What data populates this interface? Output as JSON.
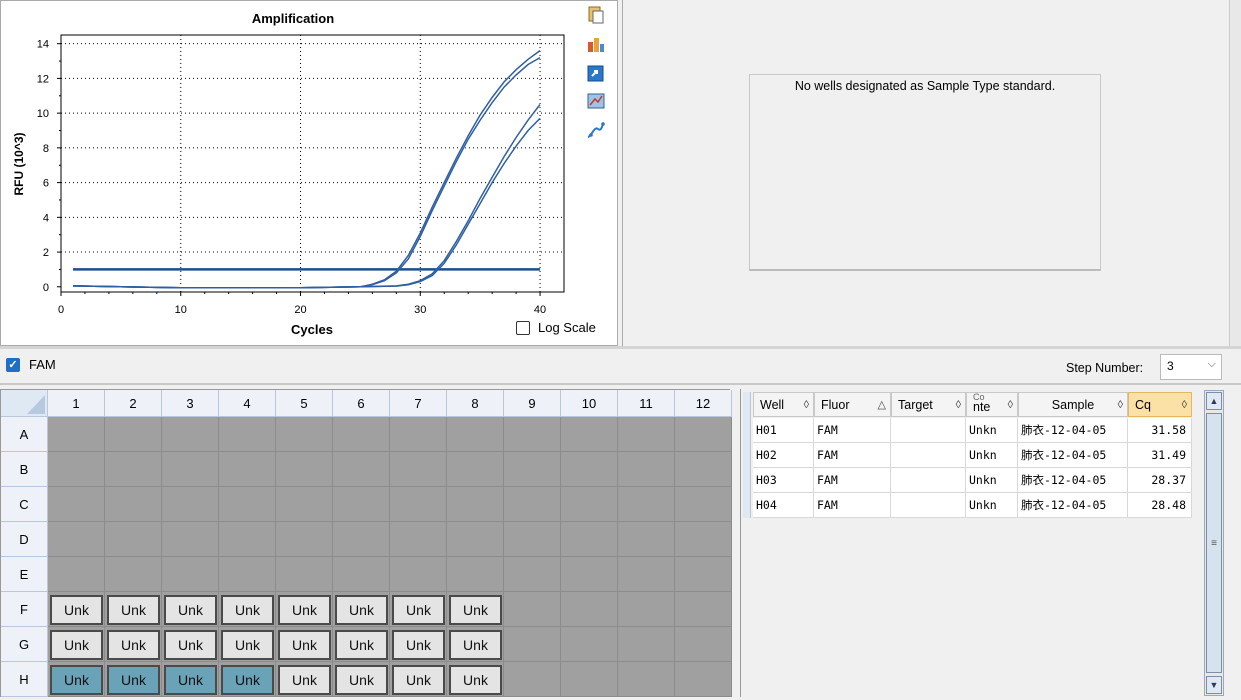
{
  "chart": {
    "log_scale_label": "Log Scale",
    "log_scale_checked": false
  },
  "chart_data": {
    "type": "line",
    "title": "Amplification",
    "xlabel": "Cycles",
    "ylabel": "RFU (10^3)",
    "xlim": [
      0,
      42
    ],
    "ylim": [
      -0.3,
      14.5
    ],
    "xticks": [
      "0",
      "10",
      "20",
      "30",
      "40"
    ],
    "yticks": [
      "0",
      "2",
      "4",
      "6",
      "8",
      "10",
      "12",
      "14"
    ],
    "grid": true,
    "threshold": 1.0,
    "series": [
      {
        "x": [
          1,
          5,
          10,
          15,
          20,
          25,
          26,
          27,
          28,
          29,
          30,
          31,
          32,
          33,
          34,
          35,
          36,
          37,
          38,
          39,
          40
        ],
        "y": [
          0.05,
          0.0,
          -0.05,
          -0.05,
          -0.05,
          0.0,
          0.15,
          0.4,
          0.9,
          1.8,
          3.1,
          4.6,
          6.0,
          7.4,
          8.7,
          9.9,
          10.9,
          11.8,
          12.5,
          13.1,
          13.6
        ]
      },
      {
        "x": [
          1,
          5,
          10,
          15,
          20,
          25,
          26,
          27,
          28,
          29,
          30,
          31,
          32,
          33,
          34,
          35,
          36,
          37,
          38,
          39,
          40
        ],
        "y": [
          0.05,
          0.0,
          -0.05,
          -0.05,
          -0.05,
          0.0,
          0.12,
          0.35,
          0.8,
          1.6,
          2.9,
          4.4,
          5.8,
          7.2,
          8.5,
          9.6,
          10.6,
          11.5,
          12.2,
          12.8,
          13.2
        ]
      },
      {
        "x": [
          1,
          5,
          10,
          15,
          20,
          25,
          28,
          29,
          30,
          31,
          32,
          33,
          34,
          35,
          36,
          37,
          38,
          39,
          40
        ],
        "y": [
          0.05,
          0.0,
          -0.05,
          -0.05,
          -0.05,
          0.0,
          0.05,
          0.15,
          0.35,
          0.75,
          1.5,
          2.6,
          3.8,
          5.1,
          6.3,
          7.5,
          8.6,
          9.6,
          10.5
        ]
      },
      {
        "x": [
          1,
          5,
          10,
          15,
          20,
          25,
          28,
          29,
          30,
          31,
          32,
          33,
          34,
          35,
          36,
          37,
          38,
          39,
          40
        ],
        "y": [
          0.05,
          0.0,
          -0.05,
          -0.05,
          -0.05,
          0.0,
          0.04,
          0.12,
          0.3,
          0.65,
          1.35,
          2.4,
          3.6,
          4.8,
          6.0,
          7.1,
          8.1,
          9.0,
          9.7
        ]
      }
    ]
  },
  "right_panel": {
    "message": "No wells designated as Sample Type standard."
  },
  "filter": {
    "fluor_label": "FAM",
    "fluor_checked": true,
    "step_label": "Step Number:",
    "step_value": "3"
  },
  "plate": {
    "columns": [
      "1",
      "2",
      "3",
      "4",
      "5",
      "6",
      "7",
      "8",
      "9",
      "10",
      "11",
      "12"
    ],
    "rows": [
      "A",
      "B",
      "C",
      "D",
      "E",
      "F",
      "G",
      "H"
    ],
    "well_label": "Unk"
  },
  "table": {
    "headers": {
      "well": "Well",
      "fluor": "Fluor",
      "target": "Target",
      "content_top": "Co",
      "content": "nte",
      "sample": "Sample",
      "cq": "Cq"
    },
    "rows": [
      {
        "well": "H01",
        "fluor": "FAM",
        "target": "",
        "content": "Unkn",
        "sample": "肺衣-12-04-05",
        "cq": "31.58"
      },
      {
        "well": "H02",
        "fluor": "FAM",
        "target": "",
        "content": "Unkn",
        "sample": "肺衣-12-04-05",
        "cq": "31.49"
      },
      {
        "well": "H03",
        "fluor": "FAM",
        "target": "",
        "content": "Unkn",
        "sample": "肺衣-12-04-05",
        "cq": "28.37"
      },
      {
        "well": "H04",
        "fluor": "FAM",
        "target": "",
        "content": "Unkn",
        "sample": "肺衣-12-04-05",
        "cq": "28.48"
      }
    ]
  },
  "colors": {
    "curve": "#2f5fa0",
    "threshold": "#1f4e8c",
    "selected_well": "#6aa3b8",
    "cq_header": "#fce1a6"
  }
}
